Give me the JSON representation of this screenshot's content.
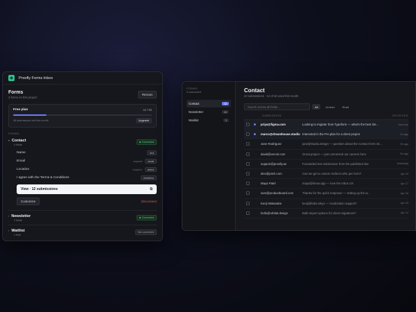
{
  "left": {
    "app_title": "Proofly Forms Inbox",
    "forms_title": "Forms",
    "forms_subtitle": "3 forms on this project",
    "rescan_label": "Rescan",
    "plan": {
      "name": "Free plan",
      "count": "12 / 50",
      "used_fraction": 0.24,
      "remaining": "38 submissions left this month",
      "upgrade_label": "Upgrade"
    },
    "section_label": "FORMS",
    "contact": {
      "name": "Contact",
      "fields_count": "4 fields",
      "status": "Connected",
      "fields": [
        {
          "label": "Name",
          "required": "",
          "type": "text"
        },
        {
          "label": "Email",
          "required": "required",
          "type": "email"
        },
        {
          "label": "Location",
          "required": "required",
          "type": "select"
        },
        {
          "label": "I agree with the Terms & Conditions",
          "required": "",
          "type": "checkbox"
        }
      ],
      "view_label": "View · 12 submissions",
      "customize_label": "Customize",
      "disconnect_label": "Disconnect"
    },
    "newsletter": {
      "name": "Newsletter",
      "fields_count": "2 fields",
      "status": "Connected"
    },
    "waitlist": {
      "name": "Waitlist",
      "fields_count": "1 field",
      "status": "Not connected"
    }
  },
  "right": {
    "side_label": "FORMS",
    "side_sub": "3 connected",
    "side_items": [
      {
        "label": "Contact",
        "count": "12"
      },
      {
        "label": "Newsletter",
        "count": "44"
      },
      {
        "label": "Waitlist",
        "count": "3"
      }
    ],
    "title": "Contact",
    "subtitle": "43 submissions · 12 of 50 used this month",
    "search_placeholder": "Search across all fields...",
    "filters": [
      "All",
      "Unread",
      "Read"
    ],
    "col_submission": "SUBMISSION",
    "col_received": "RECEIVED",
    "rows": [
      {
        "from": "priya@figma.com",
        "msg": "Looking to migrate from Typeform — what's the best tim...",
        "time": "Just now",
        "unread": true
      },
      {
        "from": "marco@dreamhouse.studio",
        "msg": "Interested in the Pro plan for a client project",
        "time": "1h ago",
        "unread": true
      },
      {
        "from": "Jane Rodriguez",
        "msg": "jane@studio.design — question about the Contact form int...",
        "time": "3h ago",
        "unread": false
      },
      {
        "from": "david@vercel.com",
        "msg": "Great project — just connected our careers form",
        "time": "5h ago",
        "unread": false
      },
      {
        "from": "support@proofly.ae",
        "msg": "Forwarded test submission from the published site",
        "time": "Yesterday",
        "unread": false
      },
      {
        "from": "alex@pitch.com",
        "msg": "Can we get a custom redirect URL per form?",
        "time": "Apr 19",
        "unread": false
      },
      {
        "from": "Maya Patel",
        "msg": "maya@linear.app — love the inbox UX",
        "time": "Apr 17",
        "unread": false
      },
      {
        "from": "sam@productboard.com",
        "msg": "Thanks for the quick response — setting up the w...",
        "time": "Apr 16",
        "unread": false
      },
      {
        "from": "Kenji Watanabe",
        "msg": "kenji@tabs.tokyo — localization support?",
        "time": "Apr 15",
        "unread": false
      },
      {
        "from": "hello@orbital.design",
        "msg": "Bulk-import options for client migrations?",
        "time": "Apr 12",
        "unread": false
      }
    ]
  }
}
